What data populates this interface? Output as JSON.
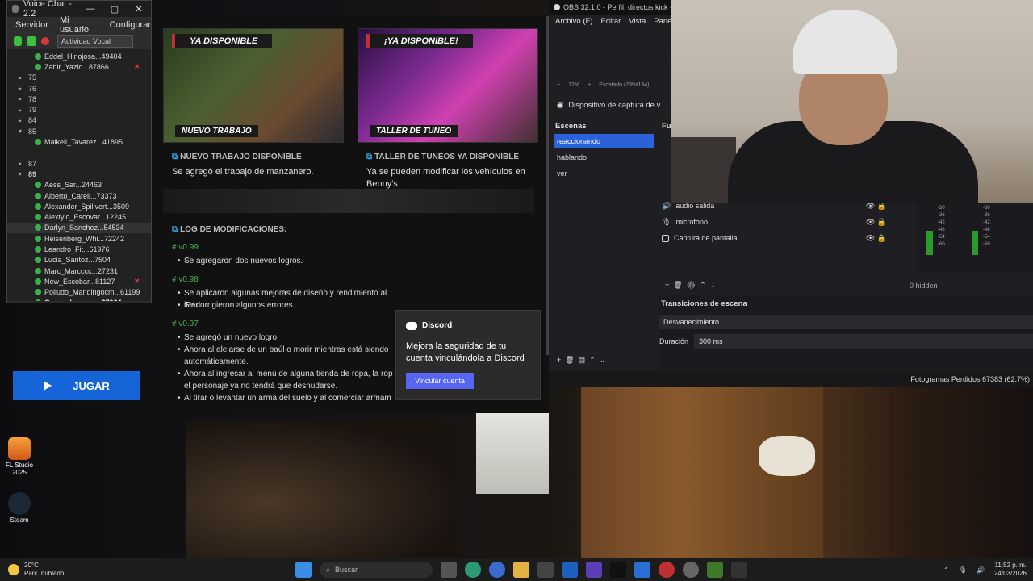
{
  "voice_chat": {
    "title": "Voice Chat - 2.2",
    "menu": [
      "Servidor",
      "Mi usuario",
      "Configurar"
    ],
    "mode": "Actividad Vocal",
    "tree": [
      {
        "kind": "user",
        "label": "Eddel_Hinojosa...49404"
      },
      {
        "kind": "user",
        "label": "Zahir_Yazid...87866",
        "muted": true
      },
      {
        "kind": "channel",
        "label": "75"
      },
      {
        "kind": "channel",
        "label": "76"
      },
      {
        "kind": "channel",
        "label": "78"
      },
      {
        "kind": "channel",
        "label": "79"
      },
      {
        "kind": "channel",
        "label": "84"
      },
      {
        "kind": "channel",
        "label": "85",
        "open": true
      },
      {
        "kind": "user",
        "label": "Maikell_Tavarez...41895"
      },
      {
        "kind": "blank",
        "label": ""
      },
      {
        "kind": "channel",
        "label": "87"
      },
      {
        "kind": "channel",
        "label": "89",
        "open": true,
        "bold": true
      },
      {
        "kind": "user",
        "label": "Aess_Sar...24463"
      },
      {
        "kind": "user",
        "label": "Alberto_Carell...73373"
      },
      {
        "kind": "user",
        "label": "Alexander_Spillvert...3509"
      },
      {
        "kind": "user",
        "label": "Alextylo_Escovar...12245"
      },
      {
        "kind": "user",
        "label": "Darlyn_Sanchez...54534",
        "hl": true
      },
      {
        "kind": "user",
        "label": "Heisenberg_Whi...72242"
      },
      {
        "kind": "user",
        "label": "Leandro_Fit...61976"
      },
      {
        "kind": "user",
        "label": "Lucia_Santoz...7504"
      },
      {
        "kind": "user",
        "label": "Marc_Marcccc...27231"
      },
      {
        "kind": "user",
        "label": "New_Escobar...81127",
        "muted": true
      },
      {
        "kind": "user",
        "label": "Polludo_Mandingocm...61199"
      },
      {
        "kind": "user",
        "label": "Quero_Lozano...37064",
        "bold": true
      }
    ]
  },
  "launcher": {
    "cards": [
      {
        "ribbon": "YA DISPONIBLE",
        "badge": "NUEVO TRABAJO",
        "title": "NUEVO TRABAJO DISPONIBLE",
        "desc": "Se agregó el trabajo de manzanero."
      },
      {
        "ribbon": "¡YA DISPONIBLE!",
        "badge": "TALLER DE TUNEO",
        "title": "TALLER DE TUNEOS YA DISPONIBLE",
        "desc": "Ya se pueden modificar los vehículos en Benny's."
      }
    ],
    "log_title": "LOG DE MODIFICACIONES:",
    "versions": [
      {
        "v": "v0.99",
        "items": [
          "Se agregaron dos nuevos logros."
        ]
      },
      {
        "v": "v0.98",
        "items": [
          "Se aplicaron algunas mejoras de diseño y rendimiento al iPad.",
          "Se corrigieron algunos errores."
        ]
      },
      {
        "v": "v0.97",
        "items": [
          "Se agregó un nuevo logro.",
          "Ahora al alejarse de un baúl o morir mientras está siendo automáticamente.",
          "Ahora al ingresar al menú de alguna tienda de ropa, la rop el personaje ya no tendrá que desnudarse.",
          "Al tirar o levantar un arma del suelo y al comerciar armam"
        ]
      }
    ],
    "play_label": "JUGAR"
  },
  "toast": {
    "app": "Discord",
    "message": "Mejora la seguridad de tu cuenta vinculándola a Discord",
    "button": "Vincular cuenta"
  },
  "obs": {
    "title": "OBS 32.1.0 - Perfil: directos kick - Escen",
    "menu": [
      "Archivo (F)",
      "Editar",
      "Vista",
      "Paneles"
    ],
    "zoom": "12%",
    "scale": "Escalado (239x134)",
    "source_device": "Dispositivo de captura de v",
    "scenes_header": "Escenas",
    "sources_header": "Fu",
    "scenes": [
      "reaccionando",
      "hablando",
      "ver"
    ],
    "sources": [
      "audio salida",
      "microfono",
      "Captura de pantalla"
    ],
    "hidden": "0 hidden",
    "db_ticks": [
      "-30",
      "-36",
      "-42",
      "-48",
      "-54",
      "-60"
    ],
    "transitions_header": "Transiciones de escena",
    "transition": "Desvanecimiento",
    "duration_label": "Duración",
    "duration": "300 ms",
    "status": "Fotogramas Perdidos 67383 (62.7%)"
  },
  "desktop_icons": [
    {
      "label": "FL Studio 2025"
    },
    {
      "label": "Steam"
    }
  ],
  "taskbar": {
    "temp": "20°C",
    "weather": "Parc. nublado",
    "search": "Buscar",
    "time": "11:52 p. m.",
    "date": "24/03/2026"
  }
}
